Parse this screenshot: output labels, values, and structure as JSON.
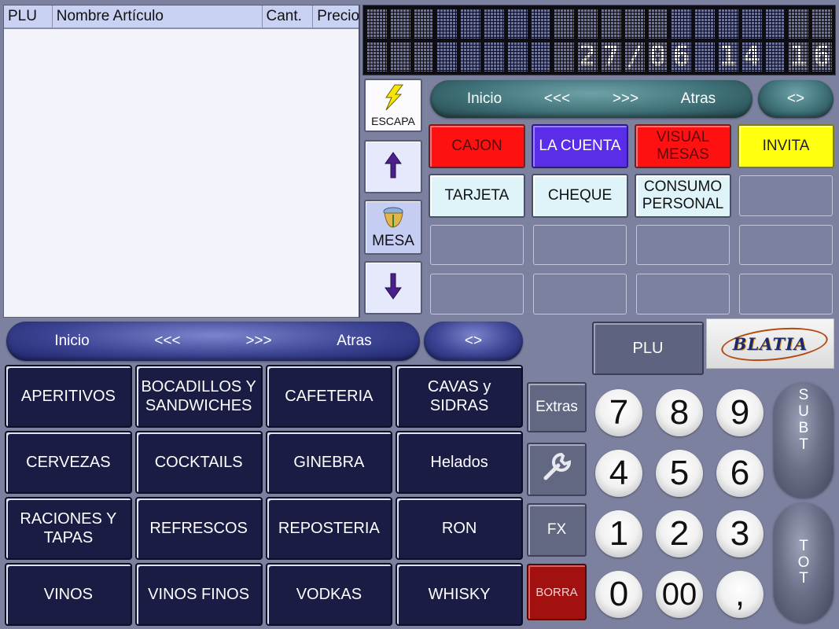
{
  "order_table": {
    "columns": [
      "PLU",
      "Nombre Artículo",
      "Cant.",
      "Precio"
    ],
    "rows": []
  },
  "led_display": {
    "line1": "",
    "line2": "27/06 14 16",
    "date": "27/06",
    "time": "14 16"
  },
  "side_buttons": {
    "escapa": {
      "label": "ESCAPA",
      "icon": "lightning-icon"
    },
    "up": {
      "icon": "arrow-up-icon"
    },
    "mesa": {
      "label": "MESA",
      "icon": "table-icon"
    },
    "down": {
      "icon": "arrow-down-icon"
    }
  },
  "nav_top": {
    "items": [
      "Inicio",
      "<<<",
      ">>>",
      "Atras"
    ],
    "toggle": "<>"
  },
  "function_buttons": [
    {
      "label": "CAJON",
      "style": "red"
    },
    {
      "label": "LA CUENTA",
      "style": "purple"
    },
    {
      "label": "VISUAL MESAS",
      "style": "red"
    },
    {
      "label": "INVITA",
      "style": "yellow"
    },
    {
      "label": "TARJETA",
      "style": "cyan"
    },
    {
      "label": "CHEQUE",
      "style": "cyan"
    },
    {
      "label": "CONSUMO PERSONAL",
      "style": "cyan"
    },
    {
      "label": "",
      "style": "empty"
    },
    {
      "label": "",
      "style": "empty"
    },
    {
      "label": "",
      "style": "empty"
    },
    {
      "label": "",
      "style": "empty"
    },
    {
      "label": "",
      "style": "empty"
    },
    {
      "label": "",
      "style": "empty"
    },
    {
      "label": "",
      "style": "empty"
    },
    {
      "label": "",
      "style": "empty"
    },
    {
      "label": "",
      "style": "empty"
    }
  ],
  "nav_bottom": {
    "items": [
      "Inicio",
      "<<<",
      ">>>",
      "Atras"
    ],
    "toggle": "<>"
  },
  "categories": [
    "APERITIVOS",
    "BOCADILLOS Y SANDWICHES",
    "CAFETERIA",
    "CAVAS y SIDRAS",
    "CERVEZAS",
    "COCKTAILS",
    "GINEBRA",
    "Helados",
    "RACIONES Y TAPAS",
    "REFRESCOS",
    "REPOSTERIA",
    "RON",
    "VINOS",
    "VINOS FINOS",
    "VODKAS",
    "WHISKY"
  ],
  "tools": {
    "extras": "Extras",
    "settings_icon": "wrench-icon",
    "fx": "FX",
    "borra": "BORRA"
  },
  "plu_button": "PLU",
  "logo_text": "BLATIA",
  "keypad": [
    "7",
    "8",
    "9",
    "4",
    "5",
    "6",
    "1",
    "2",
    "3",
    "0",
    "00",
    ","
  ],
  "subt": [
    "S",
    "U",
    "B",
    "T"
  ],
  "tot": [
    "T",
    "O",
    "T"
  ],
  "colors": {
    "background": "#7c819f",
    "category_button": "#1b1c44",
    "red": "#ff1111",
    "purple": "#5a2ee8",
    "yellow": "#ffff10",
    "cyan": "#dff4f8",
    "borra": "#a31010"
  }
}
